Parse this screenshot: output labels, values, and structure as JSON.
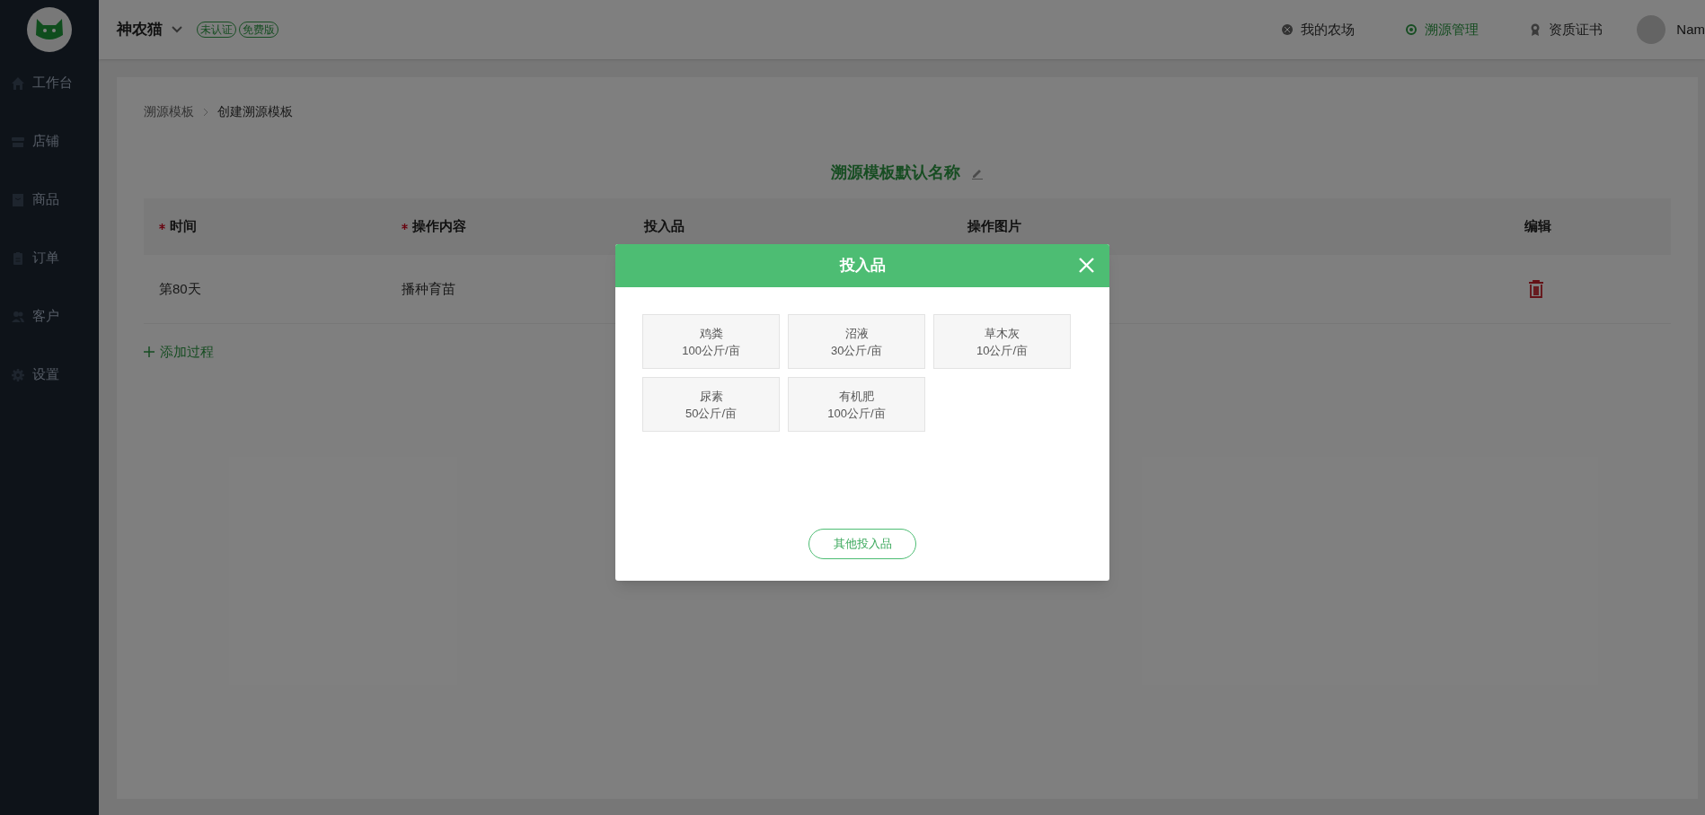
{
  "app": {
    "brand": "神农猫",
    "badges": [
      "未认证",
      "免费版"
    ]
  },
  "sidebar": {
    "items": [
      {
        "label": "工作台"
      },
      {
        "label": "店铺"
      },
      {
        "label": "商品"
      },
      {
        "label": "订单"
      },
      {
        "label": "客户"
      },
      {
        "label": "设置"
      }
    ]
  },
  "top_nav": [
    {
      "label": "我的农场",
      "selected": false
    },
    {
      "label": "溯源管理",
      "selected": true
    },
    {
      "label": "资质证书",
      "selected": false
    }
  ],
  "user": {
    "name": "Nam"
  },
  "breadcrumb": [
    "溯源模板",
    "创建溯源模板"
  ],
  "template_title": "溯源模板默认名称",
  "table": {
    "columns": [
      {
        "label": "时间",
        "required": true
      },
      {
        "label": "操作内容",
        "required": true
      },
      {
        "label": "投入品",
        "required": false
      },
      {
        "label": "操作图片",
        "required": false
      },
      {
        "label": "编辑",
        "required": false
      }
    ],
    "rows": [
      {
        "cells": [
          "第80天",
          "播种育苗"
        ]
      }
    ]
  },
  "add_process": "添加过程",
  "dialog": {
    "title": "投入品",
    "items": [
      {
        "name": "鸡粪",
        "amount": "100公斤/亩"
      },
      {
        "name": "沼液",
        "amount": "30公斤/亩"
      },
      {
        "name": "草木灰",
        "amount": "10公斤/亩"
      },
      {
        "name": "尿素",
        "amount": "50公斤/亩"
      },
      {
        "name": "有机肥",
        "amount": "100公斤/亩"
      }
    ],
    "other_button": "其他投入品"
  }
}
